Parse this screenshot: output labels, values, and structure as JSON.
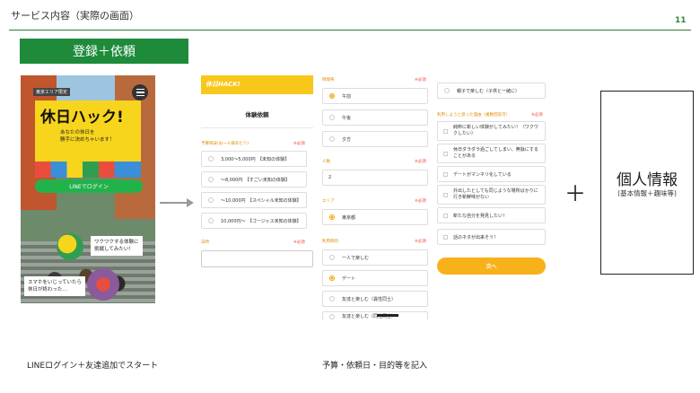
{
  "slide": {
    "title": "サービス内容（実際の画面）",
    "page_number": "11",
    "section_label": "登録＋依頼",
    "accent_color": "#1e8b3a"
  },
  "phone1": {
    "area_badge": "東京エリア限定",
    "logo": "休日ハック!",
    "catch_line1": "あなたの休日を",
    "catch_line2": "勝手に決めちゃいます！",
    "line_button": "LINEでログイン",
    "bubble1_line1": "ワクワクする体験に",
    "bubble1_line2": "挑戦してみたい！",
    "bubble2_line1": "スマホをいじっていたら",
    "bubble2_line2": "休日が終わった…"
  },
  "phone2": {
    "header_logo": "休日HACK!",
    "title": "体験依頼",
    "budget_label": "予算目安(お一人様あたり)",
    "required": "※必須",
    "budget_options": [
      "3,000〜5,000円　【未知の体験】",
      "〜8,000円　【すごい未知の体験】",
      "〜10,000円　【スペシャル未知の体験】",
      "10,000円〜　【ゴージャス未知の体験】"
    ],
    "date_label": "日時"
  },
  "phone3": {
    "time_label": "時間帯",
    "time_options": [
      "午前",
      "午後",
      "夕方"
    ],
    "people_label": "人数",
    "people_value": "2",
    "area_label": "エリア",
    "area_value": "東京都",
    "purpose_label": "利用目的",
    "purpose_options": [
      "一人で楽しむ",
      "デート",
      "友達と楽しむ（異性同士）",
      "友達と楽しむ（同性同士）"
    ]
  },
  "phone4": {
    "top_option": "親子で楽しむ（子供と一緒に）",
    "reason_label": "利用しようと思った理由（複数回答可）",
    "reasons": [
      "純粋に新しい体験がしてみたい！（ワクワクしたい）",
      "休日ダラダラ過ごしてしまい、無駄にすることがある",
      "デートがマンネリ化している",
      "外出したとしても同じような場所ばかりに行き新鮮味がない",
      "新たな自分を発見したい！",
      "話のネタが出来そう！"
    ],
    "next_button": "次へ"
  },
  "plus_sign": "＋",
  "info_box": {
    "title": "個人情報",
    "subtitle": "(基本情報＋趣味等)"
  },
  "captions": {
    "left": "LINEログイン＋友達追加でスタート",
    "right": "予算・依頼日・目的等を記入"
  }
}
